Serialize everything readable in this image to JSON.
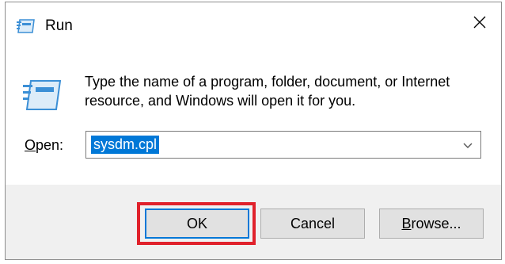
{
  "window": {
    "title": "Run",
    "title_icon": "run-icon",
    "close_icon": "close-icon"
  },
  "content": {
    "icon": "run-icon",
    "message": "Type the name of a program, folder, document, or Internet resource, and Windows will open it for you.",
    "open_label_accel": "O",
    "open_label_rest": "pen:",
    "input_value": "sysdm.cpl",
    "dropdown_icon": "chevron-down-icon"
  },
  "buttons": {
    "ok": "OK",
    "cancel": "Cancel",
    "browse_accel": "B",
    "browse_rest": "rowse..."
  },
  "colors": {
    "selection": "#0078d7",
    "highlight_box": "#e0212b",
    "icon_blue": "#3b8fd6"
  }
}
